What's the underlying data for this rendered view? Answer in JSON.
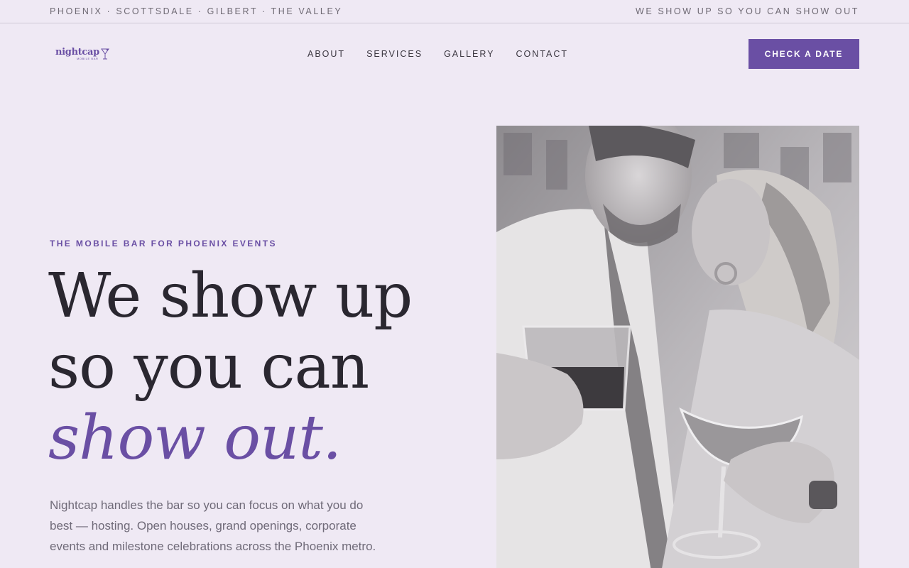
{
  "topbar": {
    "locations": "PHOENIX · SCOTTSDALE · GILBERT · THE VALLEY",
    "tagline": "WE SHOW UP SO YOU CAN SHOW OUT"
  },
  "brand": {
    "name": "nightcap",
    "subtitle": "MOBILE BAR",
    "accent_color": "#6a4fa4"
  },
  "nav": {
    "items": [
      {
        "label": "ABOUT"
      },
      {
        "label": "SERVICES"
      },
      {
        "label": "GALLERY"
      },
      {
        "label": "CONTACT"
      }
    ],
    "cta_label": "CHECK A DATE"
  },
  "hero": {
    "eyebrow": "THE MOBILE BAR FOR PHOENIX EVENTS",
    "headline_line1": "We show up",
    "headline_line2": "so you can",
    "headline_accent": "show out.",
    "lead": "Nightcap handles the bar so you can focus on what you do best — hosting. Open houses, grand openings, corporate events and milestone celebrations across the Phoenix metro."
  },
  "colors": {
    "background": "#efe9f4",
    "accent": "#6a4fa4",
    "text": "#2a2730"
  }
}
